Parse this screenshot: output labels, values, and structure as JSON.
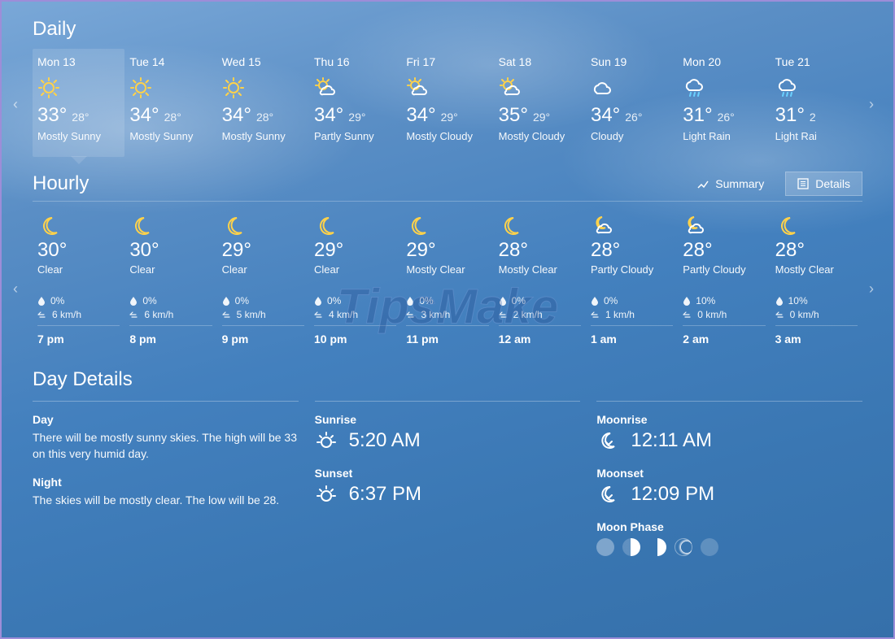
{
  "watermark": "TipsMake",
  "daily": {
    "title": "Daily",
    "items": [
      {
        "day": "Mon 13",
        "icon": "sun",
        "hi": "33°",
        "lo": "28°",
        "cond": "Mostly Sunny",
        "selected": true
      },
      {
        "day": "Tue 14",
        "icon": "sun",
        "hi": "34°",
        "lo": "28°",
        "cond": "Mostly Sunny"
      },
      {
        "day": "Wed 15",
        "icon": "sun",
        "hi": "34°",
        "lo": "28°",
        "cond": "Mostly Sunny"
      },
      {
        "day": "Thu 16",
        "icon": "partly",
        "hi": "34°",
        "lo": "29°",
        "cond": "Partly Sunny"
      },
      {
        "day": "Fri 17",
        "icon": "partly",
        "hi": "34°",
        "lo": "29°",
        "cond": "Mostly Cloudy"
      },
      {
        "day": "Sat 18",
        "icon": "partly",
        "hi": "35°",
        "lo": "29°",
        "cond": "Mostly Cloudy"
      },
      {
        "day": "Sun 19",
        "icon": "cloud",
        "hi": "34°",
        "lo": "26°",
        "cond": "Cloudy"
      },
      {
        "day": "Mon 20",
        "icon": "rain",
        "hi": "31°",
        "lo": "26°",
        "cond": "Light Rain"
      },
      {
        "day": "Tue 21",
        "icon": "rain",
        "hi": "31°",
        "lo": "2",
        "cond": "Light Rai"
      }
    ]
  },
  "hourly": {
    "title": "Hourly",
    "summary_label": "Summary",
    "details_label": "Details",
    "items": [
      {
        "time": "7 pm",
        "icon": "moon",
        "temp": "30°",
        "cond": "Clear",
        "precip": "0%",
        "wind": "6 km/h"
      },
      {
        "time": "8 pm",
        "icon": "moon",
        "temp": "30°",
        "cond": "Clear",
        "precip": "0%",
        "wind": "6 km/h"
      },
      {
        "time": "9 pm",
        "icon": "moon",
        "temp": "29°",
        "cond": "Clear",
        "precip": "0%",
        "wind": "5 km/h"
      },
      {
        "time": "10 pm",
        "icon": "moon",
        "temp": "29°",
        "cond": "Clear",
        "precip": "0%",
        "wind": "4 km/h"
      },
      {
        "time": "11 pm",
        "icon": "moon",
        "temp": "29°",
        "cond": "Mostly Clear",
        "precip": "0%",
        "wind": "3 km/h"
      },
      {
        "time": "12 am",
        "icon": "moon",
        "temp": "28°",
        "cond": "Mostly Clear",
        "precip": "0%",
        "wind": "2 km/h"
      },
      {
        "time": "1 am",
        "icon": "cloudnight",
        "temp": "28°",
        "cond": "Partly Cloudy",
        "precip": "0%",
        "wind": "1 km/h"
      },
      {
        "time": "2 am",
        "icon": "cloudnight",
        "temp": "28°",
        "cond": "Partly Cloudy",
        "precip": "10%",
        "wind": "0 km/h"
      },
      {
        "time": "3 am",
        "icon": "moon",
        "temp": "28°",
        "cond": "Mostly Clear",
        "precip": "10%",
        "wind": "0 km/h"
      }
    ]
  },
  "details": {
    "title": "Day Details",
    "day_label": "Day",
    "day_text": "There will be mostly sunny skies. The high will be 33 on this very humid day.",
    "night_label": "Night",
    "night_text": "The skies will be mostly clear. The low will be 28.",
    "sunrise_label": "Sunrise",
    "sunrise_time": "5:20 AM",
    "sunset_label": "Sunset",
    "sunset_time": "6:37 PM",
    "moonrise_label": "Moonrise",
    "moonrise_time": "12:11 AM",
    "moonset_label": "Moonset",
    "moonset_time": "12:09 PM",
    "moonphase_label": "Moon Phase"
  }
}
